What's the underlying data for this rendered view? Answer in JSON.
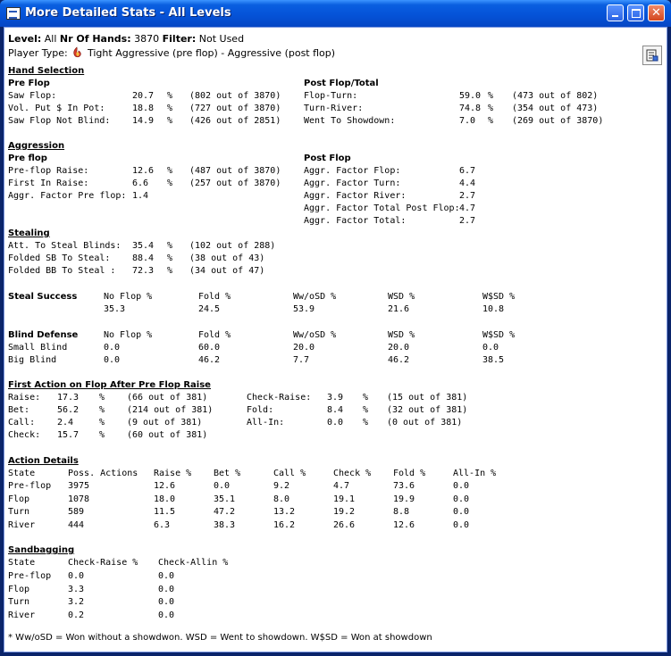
{
  "window": {
    "title": "More Detailed Stats - All Levels"
  },
  "top": {
    "level_label": "Level:",
    "level_value": "All",
    "hands_label": "Nr Of Hands:",
    "hands_value": "3870",
    "filter_label": "Filter:",
    "filter_value": "Not Used",
    "player_type_label": "Player Type:",
    "player_type_value": "Tight Aggressive (pre flop) - Aggressive (post flop)"
  },
  "hand_selection": {
    "title": "Hand Selection",
    "pre_title": "Pre Flop",
    "pre": [
      {
        "label": "Saw Flop:",
        "value": "20.7",
        "unit": "%",
        "detail": "(802 out of 3870)"
      },
      {
        "label": "Vol. Put $ In Pot:",
        "value": "18.8",
        "unit": "%",
        "detail": "(727 out of 3870)"
      },
      {
        "label": "Saw Flop Not Blind:",
        "value": "14.9",
        "unit": "%",
        "detail": "(426 out of 2851)"
      }
    ],
    "post_title": "Post Flop/Total",
    "post": [
      {
        "label": "Flop-Turn:",
        "value": "59.0",
        "unit": "%",
        "detail": "(473 out of 802)"
      },
      {
        "label": "Turn-River:",
        "value": "74.8",
        "unit": "%",
        "detail": "(354 out of 473)"
      },
      {
        "label": "Went To Showdown:",
        "value": "7.0",
        "unit": "%",
        "detail": "(269 out of 3870)"
      }
    ]
  },
  "aggression": {
    "title": "Aggression",
    "pre_title": "Pre flop",
    "pre": [
      {
        "label": "Pre-flop Raise:",
        "value": "12.6",
        "unit": "%",
        "detail": "(487 out of 3870)"
      },
      {
        "label": "First In Raise:",
        "value": "6.6",
        "unit": "%",
        "detail": "(257 out of 3870)"
      },
      {
        "label": "Aggr. Factor Pre flop:",
        "value": "1.4"
      }
    ],
    "post_title": "Post Flop",
    "post": [
      {
        "label": "Aggr. Factor Flop:",
        "value": "6.7"
      },
      {
        "label": "Aggr. Factor Turn:",
        "value": "4.4"
      },
      {
        "label": "Aggr. Factor River:",
        "value": "2.7"
      },
      {
        "label": "Aggr. Factor Total Post Flop:",
        "value": "4.7"
      },
      {
        "label": "Aggr. Factor Total:",
        "value": "2.7"
      }
    ]
  },
  "stealing": {
    "title": "Stealing",
    "rows": [
      {
        "label": "Att. To Steal Blinds:",
        "value": "35.4",
        "unit": "%",
        "detail": "(102 out of 288)"
      },
      {
        "label": "Folded SB To Steal:",
        "value": "88.4",
        "unit": "%",
        "detail": "(38 out of 43)"
      },
      {
        "label": "Folded BB To Steal :",
        "value": "72.3",
        "unit": "%",
        "detail": "(34 out of 47)"
      }
    ]
  },
  "steal_success": {
    "title": "Steal Success",
    "headers": [
      "No Flop %",
      "Fold %",
      "Ww/oSD %",
      "WSD %",
      "W$SD %"
    ],
    "values": [
      "35.3",
      "24.5",
      "53.9",
      "21.6",
      "10.8"
    ]
  },
  "blind_defense": {
    "title": "Blind Defense",
    "headers": [
      "No Flop %",
      "Fold %",
      "Ww/oSD %",
      "WSD %",
      "W$SD %"
    ],
    "rows": [
      {
        "label": "Small Blind",
        "values": [
          "0.0",
          "60.0",
          "20.0",
          "20.0",
          "0.0"
        ]
      },
      {
        "label": "Big Blind",
        "values": [
          "0.0",
          "46.2",
          "7.7",
          "46.2",
          "38.5"
        ]
      }
    ]
  },
  "first_action": {
    "title": "First Action on Flop After Pre Flop Raise",
    "left": [
      {
        "label": "Raise:",
        "value": "17.3",
        "unit": "%",
        "detail": "(66 out of 381)"
      },
      {
        "label": "Bet:",
        "value": "56.2",
        "unit": "%",
        "detail": "(214 out of 381)"
      },
      {
        "label": "Call:",
        "value": "2.4",
        "unit": "%",
        "detail": "(9 out of 381)"
      },
      {
        "label": "Check:",
        "value": "15.7",
        "unit": "%",
        "detail": "(60 out of 381)"
      }
    ],
    "right": [
      {
        "label": "Check-Raise:",
        "value": "3.9",
        "unit": "%",
        "detail": "(15 out of 381)"
      },
      {
        "label": "Fold:",
        "value": "8.4",
        "unit": "%",
        "detail": "(32 out of 381)"
      },
      {
        "label": "All-In:",
        "value": "0.0",
        "unit": "%",
        "detail": "(0 out of 381)"
      }
    ]
  },
  "action_details": {
    "title": "Action Details",
    "headers": [
      "State",
      "Poss. Actions",
      "Raise %",
      "Bet %",
      "Call %",
      "Check %",
      "Fold %",
      "All-In %"
    ],
    "rows": [
      [
        "Pre-flop",
        "3975",
        "12.6",
        "0.0",
        "9.2",
        "4.7",
        "73.6",
        "0.0"
      ],
      [
        "Flop",
        "1078",
        "18.0",
        "35.1",
        "8.0",
        "19.1",
        "19.9",
        "0.0"
      ],
      [
        "Turn",
        "589",
        "11.5",
        "47.2",
        "13.2",
        "19.2",
        "8.8",
        "0.0"
      ],
      [
        "River",
        "444",
        "6.3",
        "38.3",
        "16.2",
        "26.6",
        "12.6",
        "0.0"
      ]
    ]
  },
  "sandbagging": {
    "title": "Sandbagging",
    "headers": [
      "State",
      "Check-Raise %",
      "Check-Allin %"
    ],
    "rows": [
      [
        "Pre-flop",
        "0.0",
        "0.0"
      ],
      [
        "Flop",
        "3.3",
        "0.0"
      ],
      [
        "Turn",
        "3.2",
        "0.0"
      ],
      [
        "River",
        "0.2",
        "0.0"
      ]
    ]
  },
  "footnote": "* Ww/oSD = Won without a showdwon. WSD = Went to showdown. W$SD = Won at showdown",
  "icons": {
    "player_type": "flame-icon",
    "report": "report-icon"
  }
}
